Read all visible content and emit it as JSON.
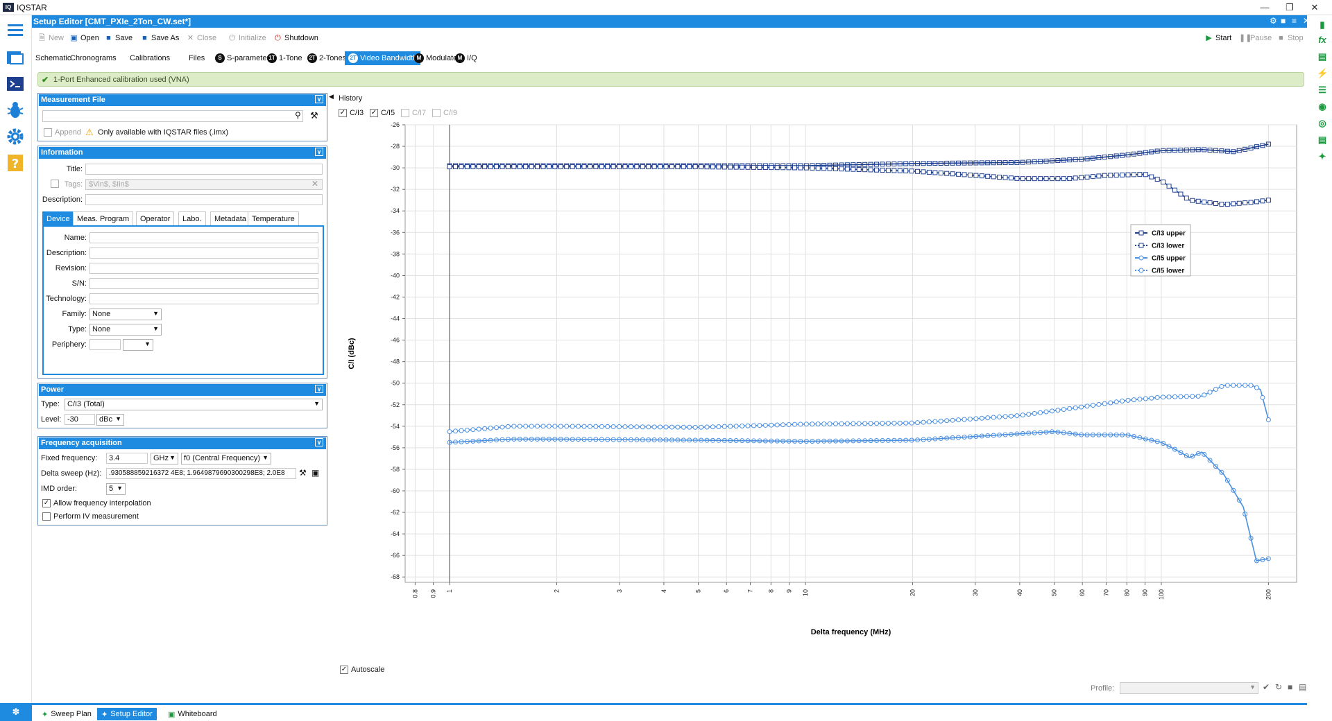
{
  "app": {
    "title": "IQSTAR"
  },
  "window": {
    "editor_title": "Setup Editor [CMT_PXIe_2Ton_CW.set*]"
  },
  "toolbar": {
    "new": "New",
    "open": "Open",
    "save": "Save",
    "save_as": "Save As",
    "close": "Close",
    "initialize": "Initialize",
    "shutdown": "Shutdown",
    "start": "Start",
    "pause": "Pause",
    "stop": "Stop"
  },
  "tabs": [
    {
      "label": "Schematic",
      "icon": ""
    },
    {
      "label": "Chronograms",
      "icon": ""
    },
    {
      "label": "Calibrations",
      "icon": ""
    },
    {
      "label": "Files",
      "icon": ""
    },
    {
      "label": "S-parameters",
      "icon": "S"
    },
    {
      "label": "1-Tone",
      "icon": "1T"
    },
    {
      "label": "2-Tones",
      "icon": "2T"
    },
    {
      "label": "Video Bandwidth",
      "icon": "2T"
    },
    {
      "label": "Modulated",
      "icon": "M"
    },
    {
      "label": "I/Q",
      "icon": "M"
    }
  ],
  "banner": {
    "text": "1-Port Enhanced calibration used (VNA)"
  },
  "measurement_file": {
    "title": "Measurement File",
    "append_label": "Append",
    "note": "Only available with IQSTAR files (.imx)"
  },
  "information": {
    "title": "Information",
    "title_label": "Title:",
    "tags_label": "Tags:",
    "tags_placeholder": "$Vin$, $Iin$",
    "description_label": "Description:",
    "subtabs": [
      "Device",
      "Meas. Program",
      "Operator",
      "Labo.",
      "Metadata",
      "Temperature"
    ],
    "device": {
      "name_label": "Name:",
      "description_label": "Description:",
      "revision_label": "Revision:",
      "sn_label": "S/N:",
      "technology_label": "Technology:",
      "family_label": "Family:",
      "family_value": "None",
      "type_label": "Type:",
      "type_value": "None",
      "periphery_label": "Periphery:"
    }
  },
  "power": {
    "title": "Power",
    "type_label": "Type:",
    "type_value": "C/I3 (Total)",
    "level_label": "Level:",
    "level_value": "-30",
    "level_unit": "dBc"
  },
  "frequency": {
    "title": "Frequency acquisition",
    "fixed_label": "Fixed frequency:",
    "fixed_value": "3.4",
    "fixed_unit": "GHz",
    "fixed_mode": "f0 (Central Frequency)",
    "delta_label": "Delta sweep (Hz):",
    "delta_value": ".930588859216372 4E8; 1.9649879690300298E8; 2.0E8",
    "imd_label": "IMD order:",
    "imd_value": "5",
    "interp_label": "Allow frequency interpolation",
    "iv_label": "Perform IV measurement"
  },
  "plot": {
    "history_label": "History",
    "checks": [
      {
        "label": "C/I3",
        "checked": true,
        "enabled": true
      },
      {
        "label": "C/I5",
        "checked": true,
        "enabled": true
      },
      {
        "label": "C/I7",
        "checked": false,
        "enabled": false
      },
      {
        "label": "C/I9",
        "checked": false,
        "enabled": false
      }
    ],
    "autoscale_label": "Autoscale"
  },
  "chart_data": {
    "type": "line",
    "title": "",
    "xlabel": "Delta frequency (MHz)",
    "ylabel": "C/I (dBc)",
    "x_scale": "log",
    "xlim": [
      0.75,
      240
    ],
    "ylim": [
      -68.5,
      -26
    ],
    "x_ticks": [
      0.8,
      0.9,
      1,
      2,
      3,
      4,
      5,
      6,
      7,
      8,
      9,
      10,
      20,
      30,
      40,
      50,
      60,
      70,
      80,
      90,
      100,
      200
    ],
    "y_ticks": [
      -26,
      -28,
      -30,
      -32,
      -34,
      -36,
      -38,
      -40,
      -42,
      -44,
      -46,
      -48,
      -50,
      -52,
      -54,
      -56,
      -58,
      -60,
      -62,
      -64,
      -66,
      -68
    ],
    "grid": true,
    "legend_position": "top-right",
    "series": [
      {
        "name": "C/I3 upper",
        "color": "#1f3f8f",
        "marker": "square",
        "x": [
          1,
          2,
          5,
          10,
          20,
          40,
          60,
          80,
          100,
          130,
          160,
          200
        ],
        "y": [
          -29.8,
          -29.8,
          -29.8,
          -29.8,
          -29.6,
          -29.5,
          -29.2,
          -28.8,
          -28.4,
          -28.3,
          -28.5,
          -27.8
        ]
      },
      {
        "name": "C/I3 lower",
        "color": "#1f3f8f",
        "marker": "square-open",
        "x": [
          1,
          2,
          5,
          10,
          20,
          30,
          40,
          55,
          70,
          90,
          100,
          120,
          150,
          180,
          200
        ],
        "y": [
          -29.9,
          -29.9,
          -29.9,
          -30.0,
          -30.3,
          -30.7,
          -31.0,
          -31.0,
          -30.7,
          -30.6,
          -31.2,
          -33.0,
          -33.4,
          -33.2,
          -33.0
        ]
      },
      {
        "name": "C/I5 upper",
        "color": "#4a8fe0",
        "marker": "circle",
        "x": [
          1,
          1.5,
          2,
          5,
          10,
          20,
          40,
          50,
          60,
          80,
          100,
          110,
          120,
          130,
          150,
          170,
          185,
          200
        ],
        "y": [
          -55.5,
          -55.2,
          -55.2,
          -55.3,
          -55.4,
          -55.3,
          -54.7,
          -54.5,
          -54.8,
          -54.8,
          -55.5,
          -56.2,
          -56.9,
          -56.4,
          -58.5,
          -61.5,
          -66.5,
          -66.3
        ]
      },
      {
        "name": "C/I5 lower",
        "color": "#4a8fe0",
        "marker": "circle-open",
        "x": [
          1,
          1.5,
          2,
          5,
          10,
          20,
          30,
          40,
          60,
          80,
          100,
          130,
          150,
          180,
          190,
          200
        ],
        "y": [
          -54.5,
          -54.0,
          -54.0,
          -54.1,
          -53.8,
          -53.7,
          -53.3,
          -53.0,
          -52.2,
          -51.6,
          -51.3,
          -51.2,
          -50.2,
          -50.2,
          -50.6,
          -53.4
        ]
      }
    ]
  },
  "profile": {
    "label": "Profile:"
  },
  "bottom_tabs": [
    {
      "label": "Sweep Plan"
    },
    {
      "label": "Setup Editor"
    },
    {
      "label": "Whiteboard"
    }
  ],
  "icons": {
    "accent": "#1e8be0",
    "green": "#1a9a3c"
  }
}
